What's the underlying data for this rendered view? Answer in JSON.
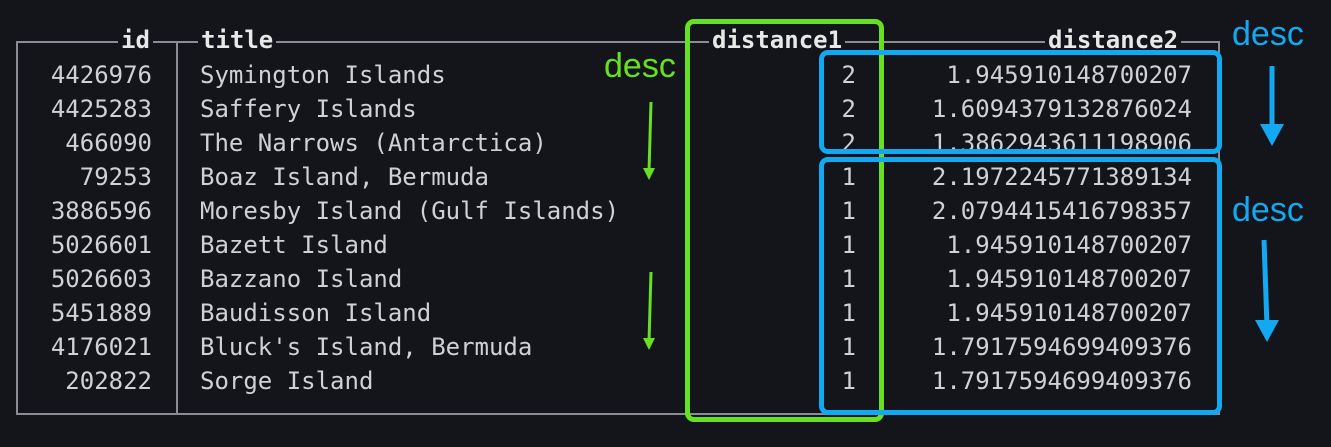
{
  "table": {
    "columns": {
      "id": "id",
      "title": "title",
      "distance1": "distance1",
      "distance2": "distance2"
    },
    "rows": [
      {
        "id": "4426976",
        "title": "Symington Islands",
        "distance1": "2",
        "distance2": "1.945910148700207"
      },
      {
        "id": "4425283",
        "title": "Saffery Islands",
        "distance1": "2",
        "distance2": "1.6094379132876024"
      },
      {
        "id": "466090",
        "title": "The Narrows (Antarctica)",
        "distance1": "2",
        "distance2": "1.3862943611198906"
      },
      {
        "id": "79253",
        "title": "Boaz Island, Bermuda",
        "distance1": "1",
        "distance2": "2.1972245771389134"
      },
      {
        "id": "3886596",
        "title": "Moresby Island (Gulf Islands)",
        "distance1": "1",
        "distance2": "2.0794415416798357"
      },
      {
        "id": "5026601",
        "title": "Bazett Island",
        "distance1": "1",
        "distance2": "1.945910148700207"
      },
      {
        "id": "5026603",
        "title": "Bazzano Island",
        "distance1": "1",
        "distance2": "1.945910148700207"
      },
      {
        "id": "5451889",
        "title": "Baudisson Island",
        "distance1": "1",
        "distance2": "1.945910148700207"
      },
      {
        "id": "4176021",
        "title": "Bluck's Island, Bermuda",
        "distance1": "1",
        "distance2": "1.7917594699409376"
      },
      {
        "id": "202822",
        "title": "Sorge Island",
        "distance1": "1",
        "distance2": "1.7917594699409376"
      }
    ]
  },
  "annotations": {
    "green_label": "desc",
    "blue_label_top": "desc",
    "blue_label_bottom": "desc",
    "green_color": "#66e021",
    "blue_color": "#12a8f2"
  }
}
